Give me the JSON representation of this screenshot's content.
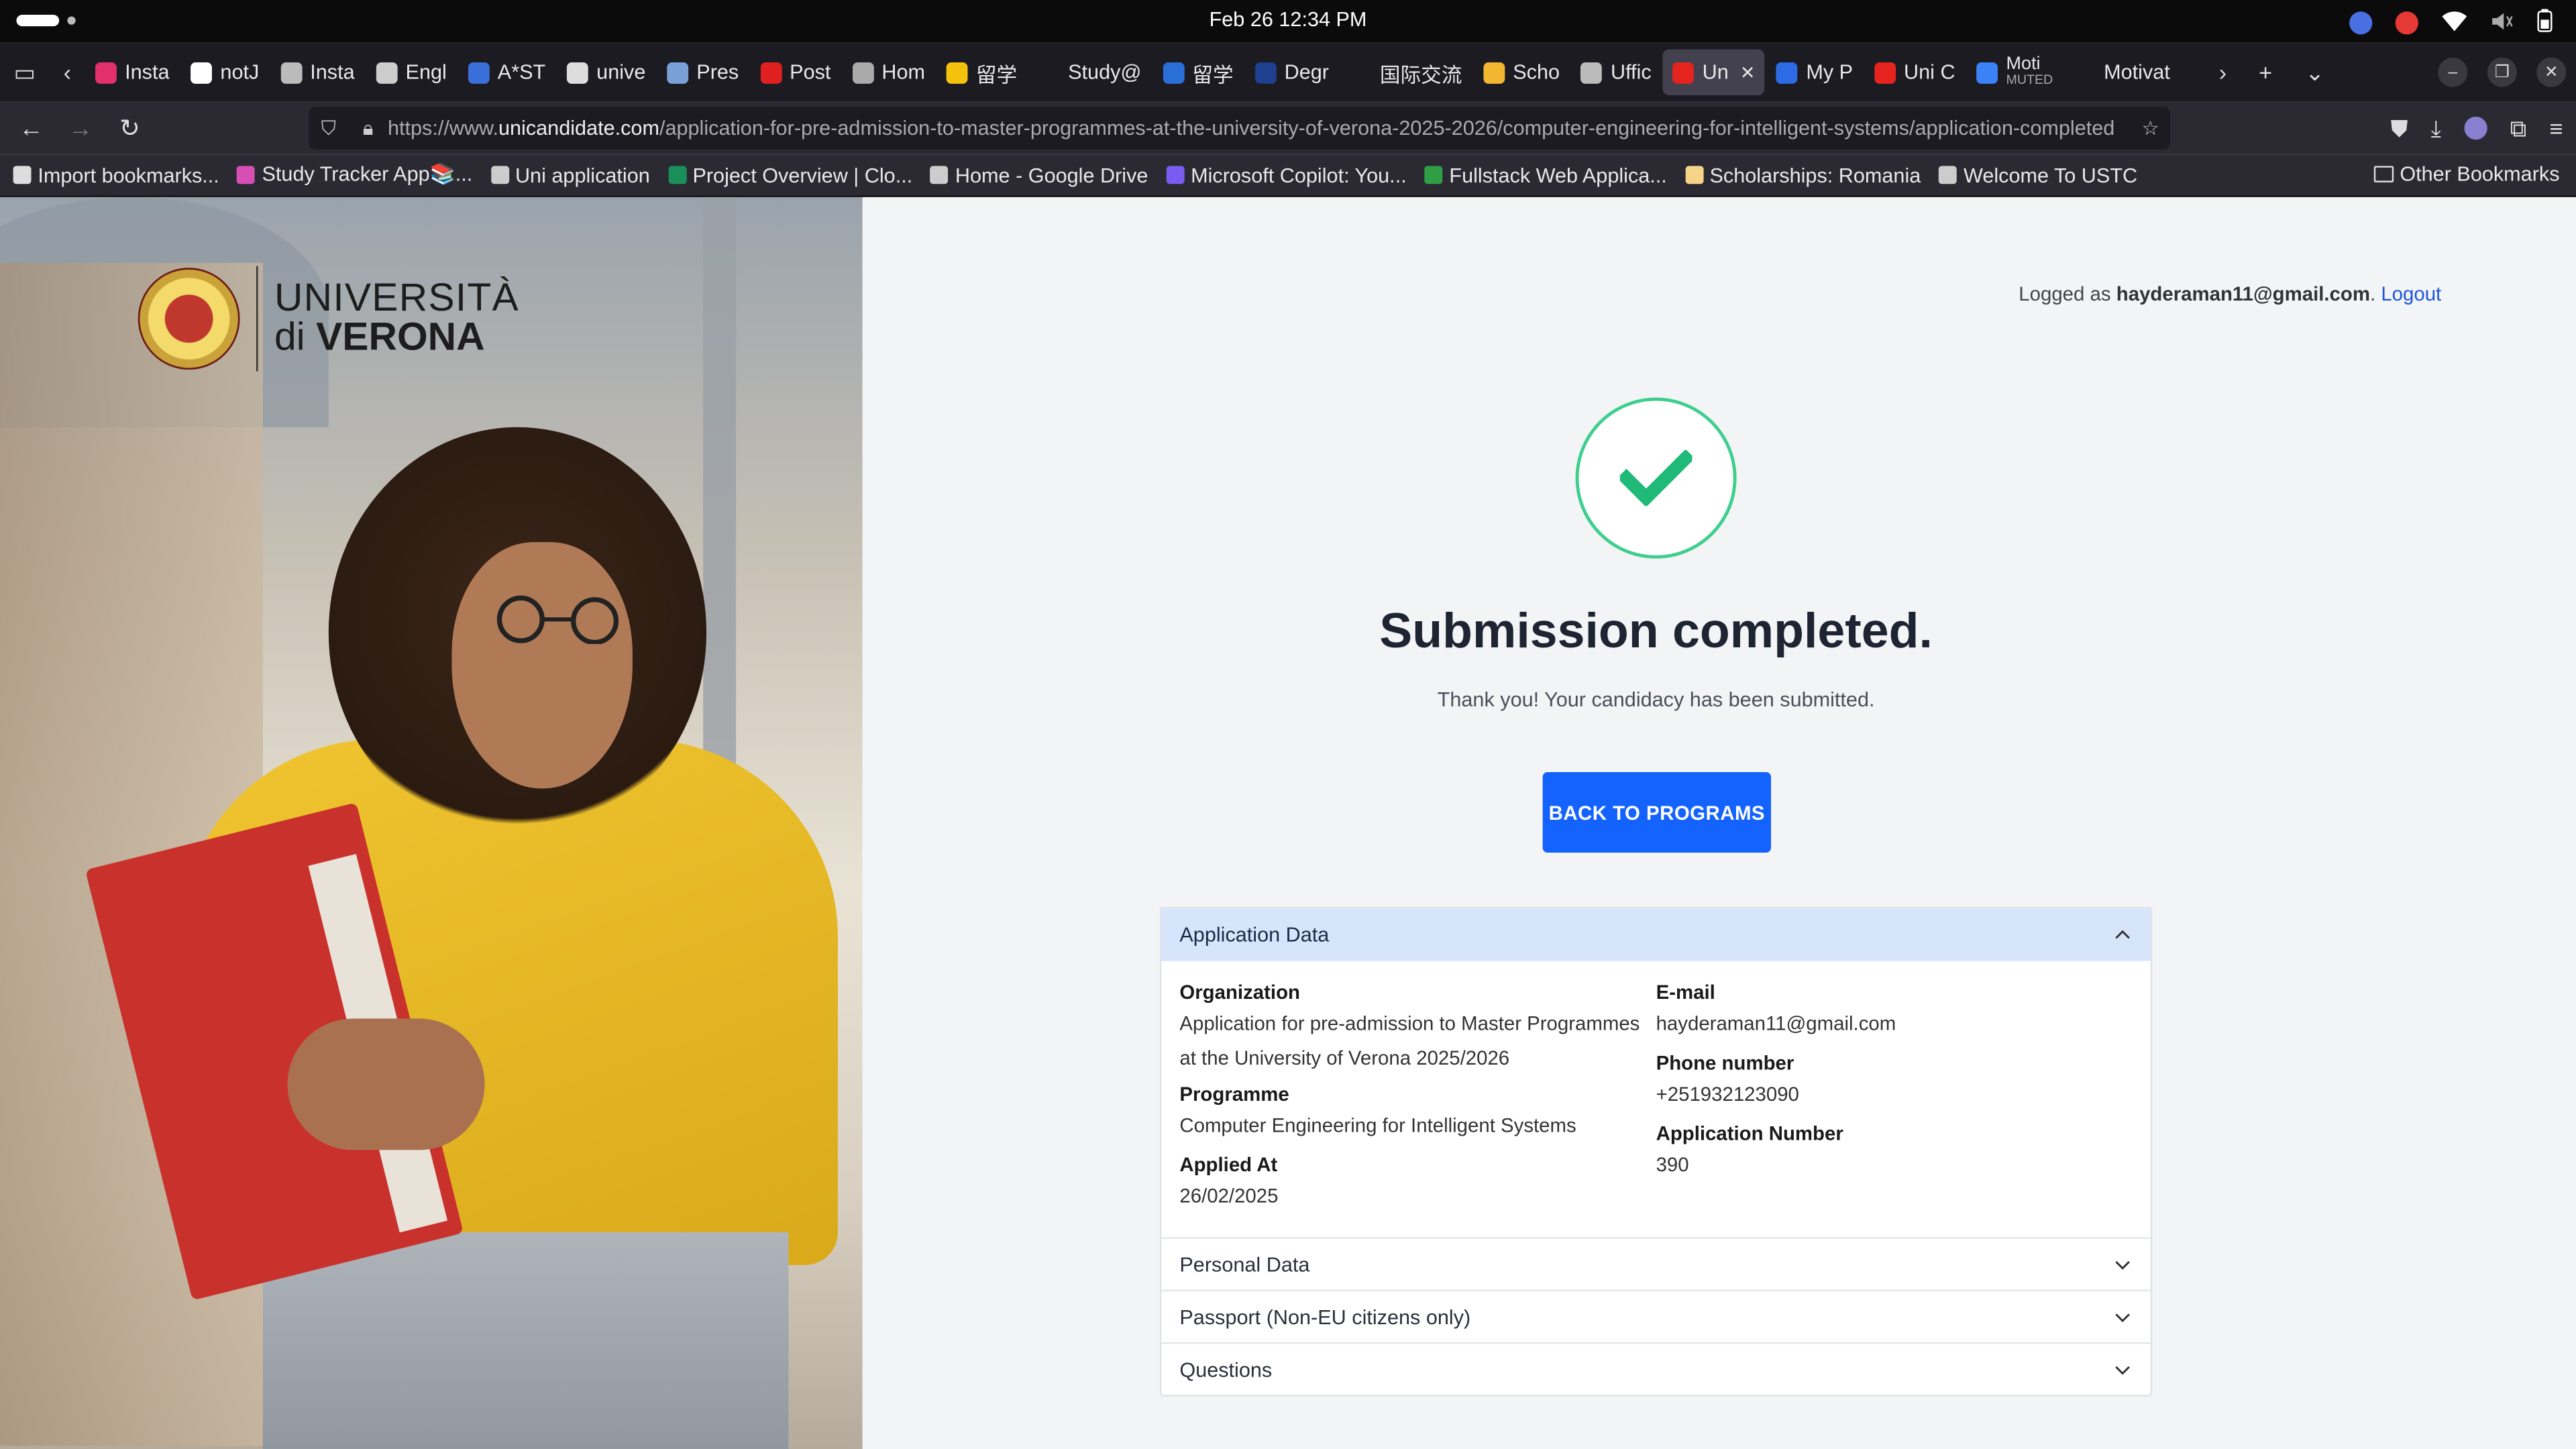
{
  "system": {
    "datetime": "Feb 26  12:34 PM"
  },
  "tabs": [
    {
      "label": "Insta",
      "color": "#e1306c"
    },
    {
      "label": "notJ",
      "color": "#ffffff"
    },
    {
      "label": "Insta",
      "color": "#bbbbbb"
    },
    {
      "label": "Engl",
      "color": "#cccccc"
    },
    {
      "label": "A*ST",
      "color": "#3b6fd8"
    },
    {
      "label": "unive",
      "color": "#dddddd"
    },
    {
      "label": "Pres",
      "color": "#7aa0d8"
    },
    {
      "label": "Post",
      "color": "#e02020"
    },
    {
      "label": "Hom",
      "color": "#aaaaaa"
    },
    {
      "label": "留学",
      "color": "#f4c20d"
    },
    {
      "label": "Study@",
      "color": "#1c1b22"
    },
    {
      "label": "留学",
      "color": "#2a6fd8"
    },
    {
      "label": "Degr",
      "color": "#1f3f8f"
    },
    {
      "label": "国际交流",
      "color": "#1c1b22"
    },
    {
      "label": "Scho",
      "color": "#f2b631"
    },
    {
      "label": "Uffic",
      "color": "#bbbbbb"
    },
    {
      "label": "Un",
      "color": "#e52420",
      "active": true
    },
    {
      "label": "My P",
      "color": "#2d6be4"
    },
    {
      "label": "Uni C",
      "color": "#e52420"
    },
    {
      "label": "Moti",
      "sub": "MUTED",
      "color": "#3b82f6"
    },
    {
      "label": "Motivat",
      "color": "#1c1b22"
    }
  ],
  "nav": {
    "url_prefix": "https://www.",
    "url_domain": "unicandidate.com",
    "url_rest": "/application-for-pre-admission-to-master-programmes-at-the-university-of-verona-2025-2026/computer-engineering-for-intelligent-systems/application-completed"
  },
  "bookmarks": [
    {
      "label": "Import bookmarks...",
      "color": "#dddddd"
    },
    {
      "label": "Study Tracker App📚...",
      "color": "#d64fb5"
    },
    {
      "label": "Uni application",
      "color": "#cccccc"
    },
    {
      "label": "Project Overview | Clo...",
      "color": "#1a8f5a"
    },
    {
      "label": "Home - Google Drive",
      "color": "#cccccc"
    },
    {
      "label": "Microsoft Copilot: You...",
      "color": "#7a5cf0"
    },
    {
      "label": "Fullstack Web Applica...",
      "color": "#2f9e44"
    },
    {
      "label": "Scholarships: Romania",
      "color": "#f5d48a"
    },
    {
      "label": "Welcome To USTC",
      "color": "#cccccc"
    }
  ],
  "bookmarks_other": "Other Bookmarks",
  "brand": {
    "line1": "UNIVERSITÀ",
    "line2_a": "di",
    "line2_b": "VERONA"
  },
  "session": {
    "prefix": "Logged as",
    "email": "hayderaman11@gmail.com",
    "logout": "Logout"
  },
  "status": {
    "title": "Submission completed.",
    "message": "Thank you! Your candidacy has been submitted.",
    "button": "BACK TO PROGRAMS",
    "accent": "#3ecf8e",
    "button_color": "#1463ff"
  },
  "application": {
    "section_title": "Application Data",
    "organization_label": "Organization",
    "organization_line1": "Application for pre-admission to Master Programmes",
    "organization_line2": "at the University of Verona 2025/2026",
    "programme_label": "Programme",
    "programme": "Computer Engineering for Intelligent Systems",
    "applied_label": "Applied At",
    "applied": "26/02/2025",
    "email_label": "E-mail",
    "email": "hayderaman11@gmail.com",
    "phone_label": "Phone number",
    "phone": "+251932123090",
    "number_label": "Application Number",
    "number": "390"
  },
  "sections": [
    {
      "label": "Personal Data"
    },
    {
      "label": "Passport (Non-EU citizens only)"
    },
    {
      "label": "Questions"
    }
  ]
}
